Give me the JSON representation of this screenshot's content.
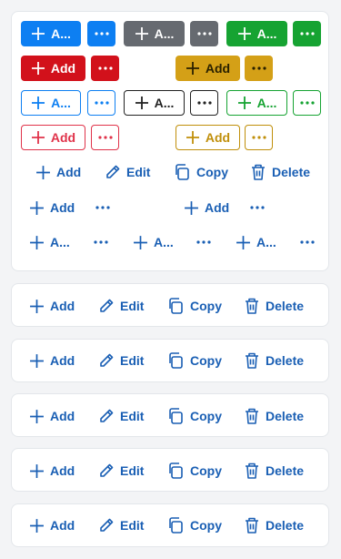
{
  "colors": {
    "blue": "#0d7ff2",
    "gray": "#666a70",
    "green": "#16a332",
    "red": "#d2111b",
    "yellow": "#d4a017",
    "black": "#222222",
    "link": "#1a5fb4"
  },
  "labels": {
    "add_truncated": "A...",
    "add": "Add",
    "edit": "Edit",
    "copy": "Copy",
    "delete": "Delete"
  }
}
